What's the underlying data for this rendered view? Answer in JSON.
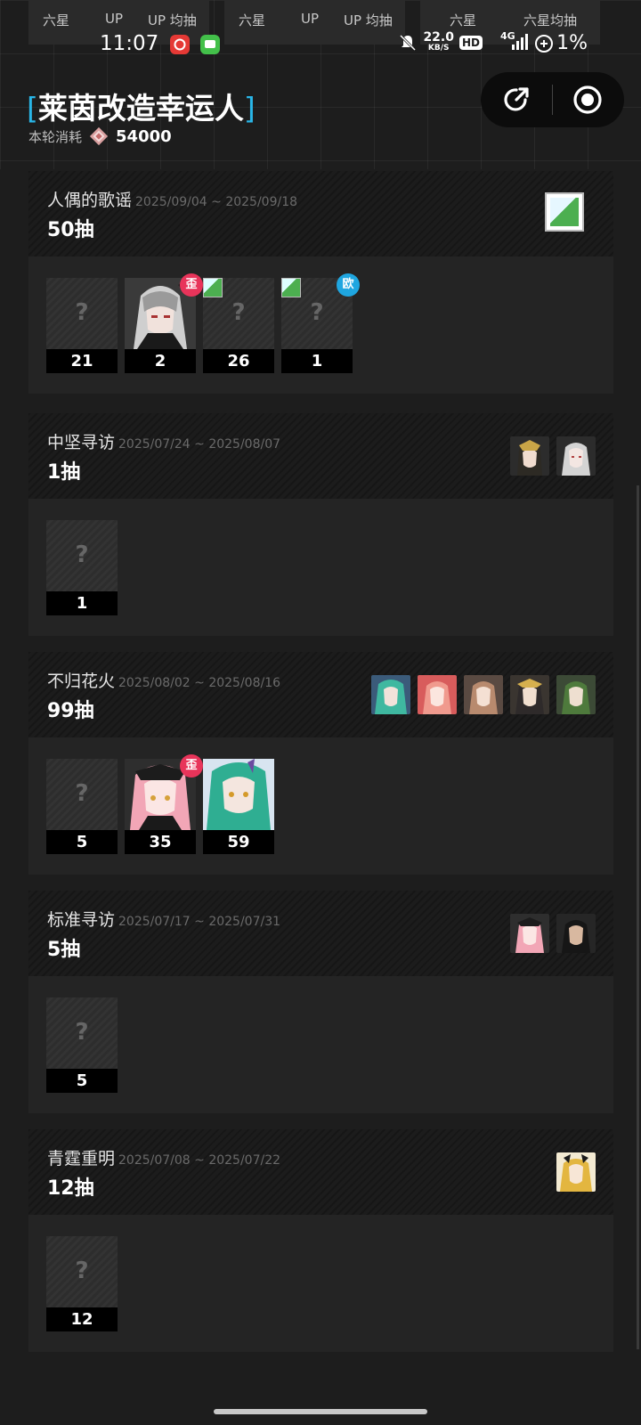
{
  "stat_strip": {
    "labels": [
      "六星",
      "UP",
      "UP 均抽",
      "六星",
      "UP",
      "UP 均抽",
      "六星",
      "六星均抽"
    ]
  },
  "status_bar": {
    "time": "11:07",
    "net_speed": "22.0",
    "net_unit": "KB/S",
    "hd": "HD",
    "signal": "4G",
    "battery": "1%"
  },
  "header": {
    "title": "莱茵改造幸运人",
    "bracket_left": "[",
    "bracket_right": "]",
    "cost_label": "本轮消耗",
    "cost_value": "54000"
  },
  "colors": {
    "accent": "#29b6e8",
    "badge_red": "#e8345a",
    "badge_blue": "#1fa6e0"
  },
  "banners": [
    {
      "name": "人偶的歌谣",
      "dates": "2025/09/04 ~ 2025/09/18",
      "pulls": "50抽",
      "cards": [
        {
          "count": "21",
          "image": "unknown"
        },
        {
          "count": "2",
          "image": "operator",
          "badge": "歪"
        },
        {
          "count": "26",
          "image": "broken"
        },
        {
          "count": "1",
          "image": "broken",
          "badge": "欧"
        }
      ]
    },
    {
      "name": "中坚寻访",
      "dates": "2025/07/24 ~ 2025/08/07",
      "pulls": "1抽",
      "cards": [
        {
          "count": "1",
          "image": "unknown"
        }
      ]
    },
    {
      "name": "不归花火",
      "dates": "2025/08/02 ~ 2025/08/16",
      "pulls": "99抽",
      "cards": [
        {
          "count": "5",
          "image": "unknown"
        },
        {
          "count": "35",
          "image": "operator",
          "badge": "歪"
        },
        {
          "count": "59",
          "image": "operator"
        }
      ]
    },
    {
      "name": "标准寻访",
      "dates": "2025/07/17 ~ 2025/07/31",
      "pulls": "5抽",
      "cards": [
        {
          "count": "5",
          "image": "unknown"
        }
      ]
    },
    {
      "name": "青霆重明",
      "dates": "2025/07/08 ~ 2025/07/22",
      "pulls": "12抽",
      "cards": [
        {
          "count": "12",
          "image": "unknown"
        }
      ]
    }
  ],
  "unknown_mark": "?"
}
